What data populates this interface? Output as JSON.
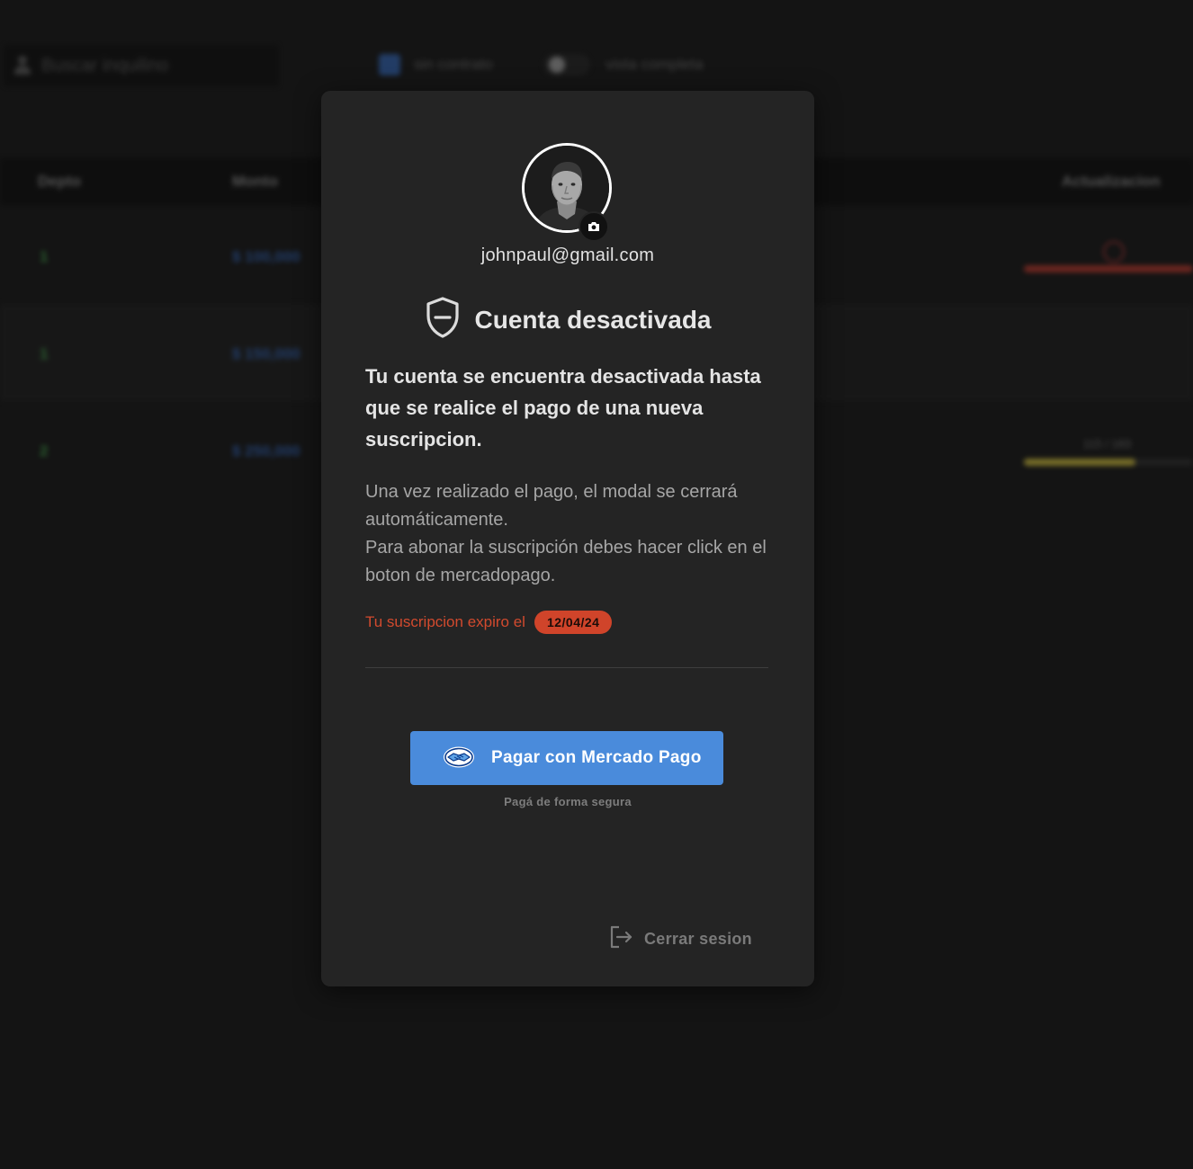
{
  "background": {
    "search_placeholder": "Buscar inquilino",
    "checkbox_label": "sin contrato",
    "toggle_label": "vista completa",
    "table": {
      "headers": [
        "Depto",
        "Monto",
        "Actualizacion"
      ],
      "rows": [
        {
          "depto": "1",
          "monto": "$ 100,000"
        },
        {
          "depto": "1",
          "monto": "$ 150,000"
        },
        {
          "depto": "2",
          "monto": "$ 250,000",
          "progress_text": "115 / 183",
          "progress": 0.66
        }
      ]
    }
  },
  "modal": {
    "email": "johnpaul@gmail.com",
    "title": "Cuenta desactivada",
    "lead": "Tu cuenta se encuentra desactivada hasta que se realice el pago de una nueva suscripcion.",
    "desc_line1": "Una vez realizado el pago, el modal se cerrará automáticamente.",
    "desc_line2": "Para abonar la suscripción debes hacer click en el boton de mercadopago.",
    "expiry_text": "Tu suscripcion expiro el",
    "expiry_date": "12/04/24",
    "pay_button": "Pagar con Mercado Pago",
    "secure_note": "Pagá de forma segura",
    "logout": "Cerrar sesion"
  },
  "colors": {
    "accent_blue": "#4a8bdb",
    "danger_red": "#d0442a",
    "modal_bg": "#242424"
  },
  "icons": [
    "avatar-photo",
    "camera-icon",
    "shield-minus-icon",
    "mercadopago-handshake-icon",
    "logout-icon"
  ]
}
